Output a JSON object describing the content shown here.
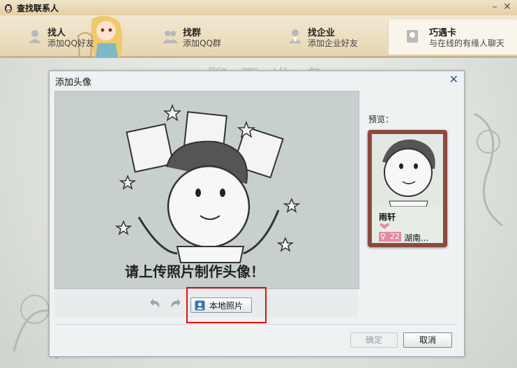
{
  "window": {
    "title": "查找联系人"
  },
  "tabs": [
    {
      "title": "找人",
      "subtitle": "添加QQ好友"
    },
    {
      "title": "找群",
      "subtitle": "添加QQ群"
    },
    {
      "title": "找企业",
      "subtitle": "添加企业好友"
    },
    {
      "title": "巧遇卡",
      "subtitle": "与在线的有缘人聊天"
    }
  ],
  "background": {
    "title": "聊天准备"
  },
  "dialog": {
    "title": "添加头像",
    "upload_prompt": "请上传照片制作头像！",
    "local_photo_label": "本地照片",
    "preview_label": "预览：",
    "card": {
      "name": "雨轩",
      "age": "22",
      "location": "湖南..."
    },
    "confirm_label": "确定",
    "cancel_label": "取消"
  },
  "colors": {
    "highlight": "#e01010",
    "card_frame": "#8c4a3f",
    "age_badge": "#e78aa0"
  }
}
